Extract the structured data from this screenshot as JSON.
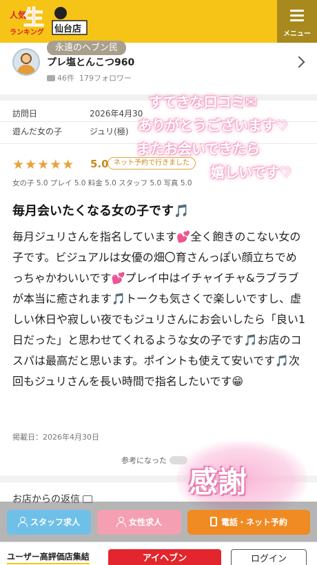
{
  "header": {
    "menu_label": "メニュー",
    "logo_text": "人気風俗店ランキング 生 店舗名称"
  },
  "reviewer": {
    "rank": "永遠のヘブン民",
    "name": "プレ塩とんこつ960",
    "reviews": "46件",
    "followers": "179フォロワー"
  },
  "visit": {
    "date_label": "訪問日",
    "date_value": "2026年4月30",
    "girl_label": "遊んだ女の子",
    "girl_value": "ジュリ(極)"
  },
  "rating": {
    "stars": "★★★★★",
    "score": "5.0",
    "badge": "ネット予約で行きました",
    "sub_scores": "女の子 5.0  プレイ 5.0  料金 5.0  スタッフ 5.0  写真 5.0"
  },
  "review": {
    "title": "毎月会いたくなる女の子です🎵",
    "body": "毎月ジュリさんを指名しています💕全く飽きのこない女の子です。ビジュアルは女優の畑〇育さんっぽい顔立ちでめっちゃかわいいです💕プレイ中はイチャイチャ&ラブラブが本当に癒されます🎵トークも気さくで楽しいですし、虚しい休日や寂しい夜でもジュリさんにお会いしたら「良い1日だった」と思わせてくれるような女の子です🎵お店のコスパは最高だと思います。ポイントも使えて安いです🎵次回もジュリさんを長い時間で指名したいです😁",
    "posted": "掲載日：2026年4月30日",
    "helpful": "参考になった"
  },
  "shop_reply": {
    "label": "お店からの返信"
  },
  "sticker": {
    "line1": "すてきな口コミ✉",
    "line2": "ありがとうございます♡",
    "line3": "またお会いできたら",
    "line4": "嬉しいです♡"
  },
  "kansha": "感謝",
  "actions": {
    "staff": "スタッフ求人",
    "female": "女性求人",
    "reserve": "電話・ネット予約"
  },
  "bottom": {
    "title": "ユーザー高評価店集結",
    "app": "アイヘブン",
    "login": "ログイン"
  },
  "colors": {
    "header": "#f6c416",
    "star": "#e8a23a",
    "staff_btn": "#6fc0e8",
    "female_btn": "#f4a0b2",
    "reserve_btn": "#f08a22",
    "sticker_pink": "#f29fc4"
  }
}
